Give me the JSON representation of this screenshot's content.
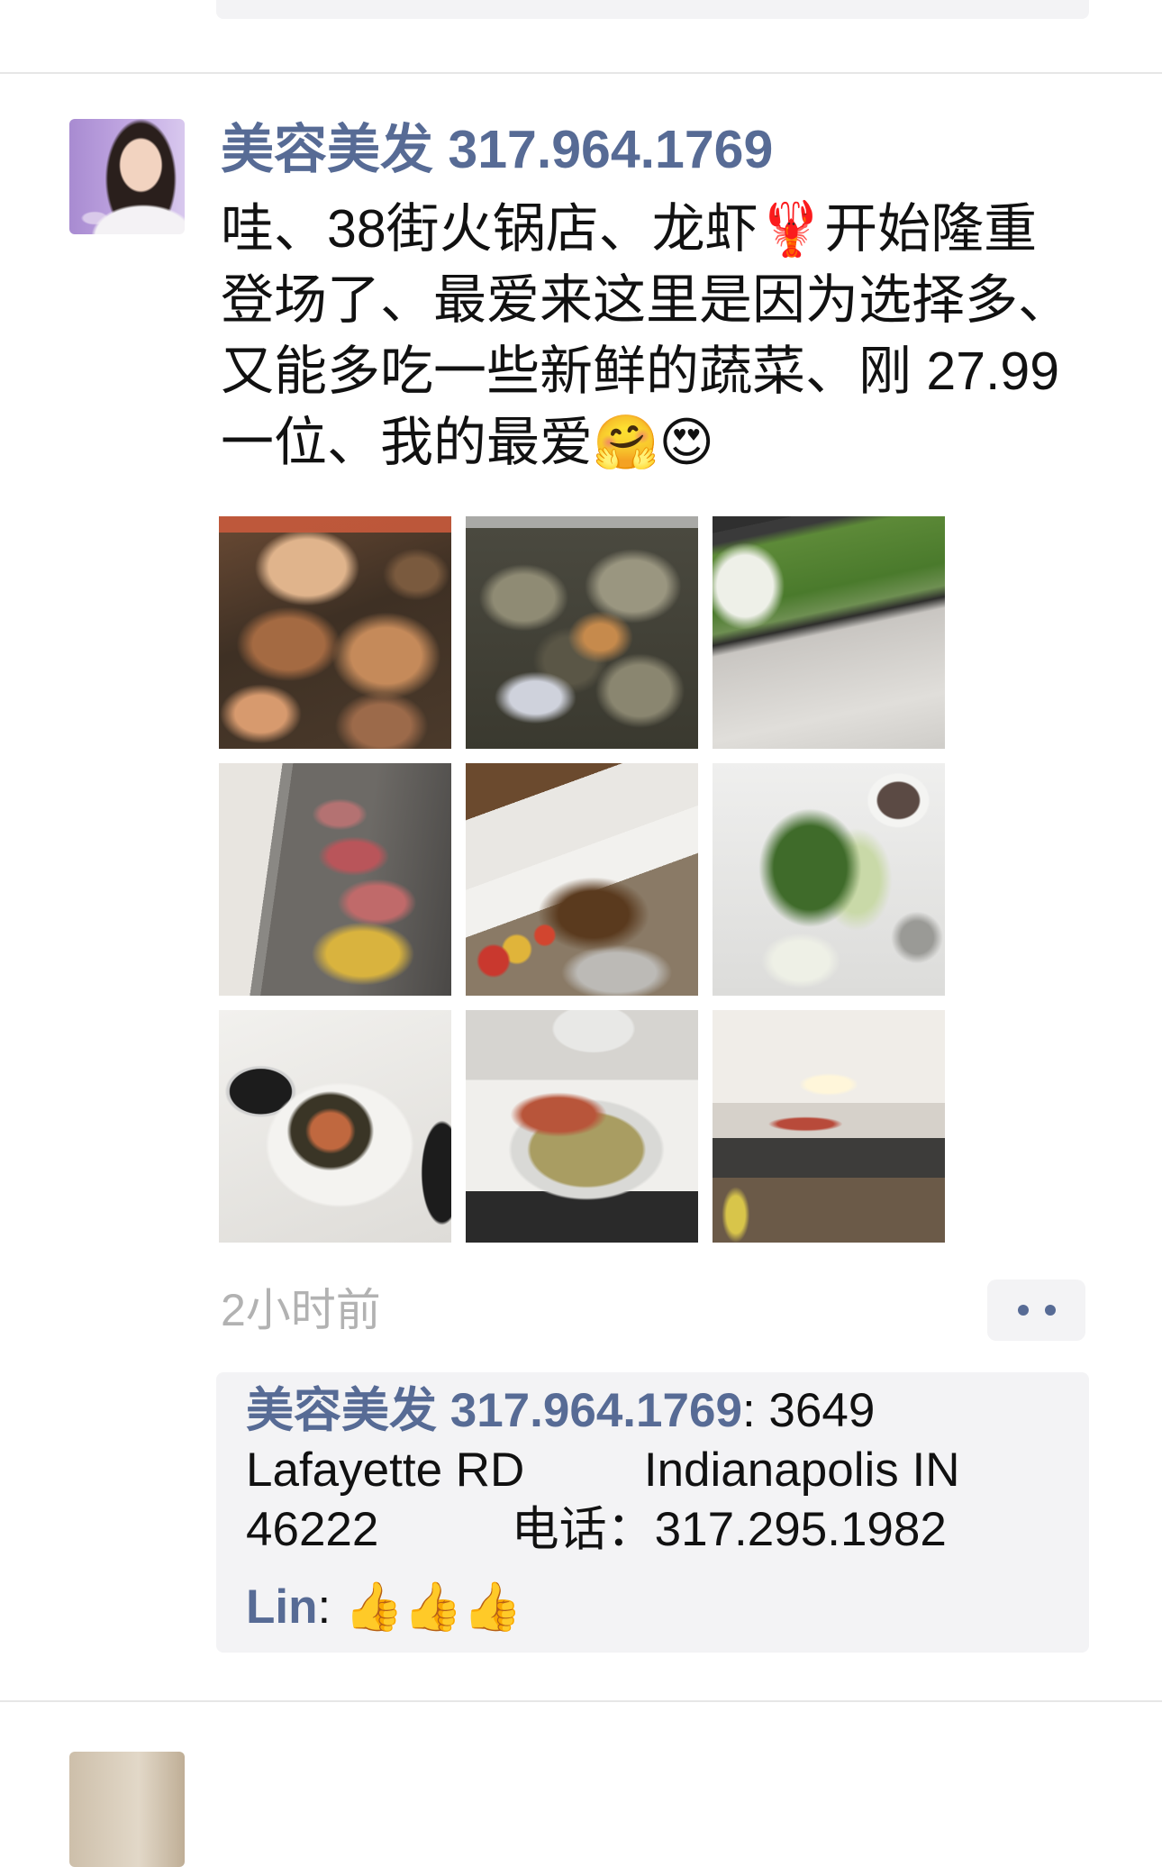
{
  "post": {
    "author": "美容美发 317.964.1769",
    "text": "哇、38街火锅店、龙虾🦞开始隆重登场了、最爱来这里是因为选择多、又能多吃一些新鲜的蔬菜、刚 27.99一位、我的最爱🤗😍",
    "time": "2小时前"
  },
  "comments": [
    {
      "name": "美容美发 317.964.1769",
      "sep": ": ",
      "content": "3649 Lafayette RD         Indianapolis IN 46222          电话：317.295.1982"
    },
    {
      "name": "Lin",
      "sep": ": ",
      "content": "👍👍👍"
    }
  ],
  "icons": {
    "more_actions": "more-dots-icon"
  },
  "colors": {
    "name": "#576b95",
    "text": "#111111",
    "time": "#b2b2b2",
    "panel_bg": "#f3f3f5",
    "divider": "#e6e6e6"
  }
}
